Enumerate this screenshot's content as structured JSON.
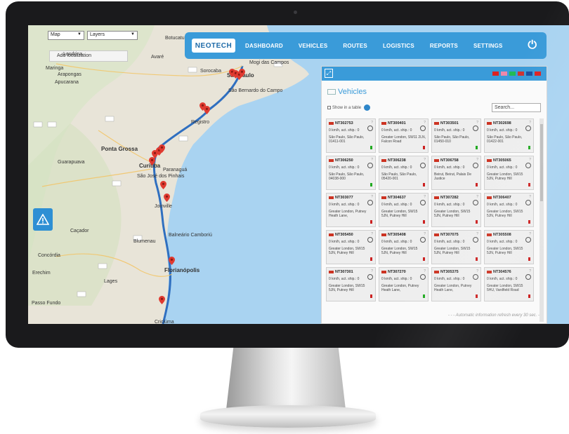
{
  "map": {
    "type_select": "Map",
    "layers_select": "Layers",
    "add_localization": "Add localization",
    "labels": [
      {
        "text": "Londrina",
        "cls": ""
      },
      {
        "text": "Maringa",
        "cls": ""
      },
      {
        "text": "Arapongas",
        "cls": ""
      },
      {
        "text": "Apucarana",
        "cls": ""
      },
      {
        "text": "Botucatu",
        "cls": ""
      },
      {
        "text": "Avaré",
        "cls": ""
      },
      {
        "text": "Sorocaba",
        "cls": ""
      },
      {
        "text": "São Paulo",
        "cls": "big"
      },
      {
        "text": "São Bernardo do Campo",
        "cls": ""
      },
      {
        "text": "Mogi das Campos",
        "cls": ""
      },
      {
        "text": "Registro",
        "cls": ""
      },
      {
        "text": "Ponta Grossa",
        "cls": "big"
      },
      {
        "text": "Guarapuava",
        "cls": ""
      },
      {
        "text": "Curitiba",
        "cls": "big"
      },
      {
        "text": "Paranaguá",
        "cls": ""
      },
      {
        "text": "São José dos Pinhais",
        "cls": ""
      },
      {
        "text": "Joinville",
        "cls": ""
      },
      {
        "text": "Caçador",
        "cls": ""
      },
      {
        "text": "Blumenau",
        "cls": ""
      },
      {
        "text": "Balneário Camboriú",
        "cls": ""
      },
      {
        "text": "Concórdia",
        "cls": ""
      },
      {
        "text": "Erechim",
        "cls": ""
      },
      {
        "text": "Lages",
        "cls": ""
      },
      {
        "text": "Florianópolis",
        "cls": "big"
      },
      {
        "text": "Passo Fundo",
        "cls": ""
      },
      {
        "text": "Criciúma",
        "cls": ""
      }
    ]
  },
  "nav": {
    "logo": "NEOTECH",
    "items": [
      "DASHBOARD",
      "VEHICLES",
      "ROUTES",
      "LOGISTICS",
      "REPORTS",
      "SETTINGS"
    ]
  },
  "panel": {
    "title": "Vehicles",
    "show_in_table": "Show in a table",
    "search_placeholder": "Search...",
    "refresh_note": "- - - Automatic information refresh every 30 sec. -",
    "flags": [
      "#d22",
      "#e8a",
      "#2b5",
      "#c33",
      "#1a4fa0",
      "#d22"
    ],
    "vehicles": [
      {
        "id": "NT302753",
        "speed": "0 km/h, act. ship.: 0",
        "addr": "São Paulo, São Paulo, 01411-001",
        "sig": "#2a2"
      },
      {
        "id": "NT300401",
        "speed": "0 km/h, act. ship.: 0",
        "addr": "Greater London, SW11 2LN, Falcon Road",
        "sig": "#c22"
      },
      {
        "id": "NT303501",
        "speed": "0 km/h, act. ship.: 0",
        "addr": "São Paulo, São Paulo, 01450-010",
        "sig": "#2a2"
      },
      {
        "id": "NT302698",
        "speed": "0 km/h, act. ship.: 0",
        "addr": "São Paulo, São Paulo, 01422-001",
        "sig": "#2a2"
      },
      {
        "id": "NT306250",
        "speed": "0 km/h, act. ship.: 0",
        "addr": "São Paulo, São Paulo, 04038-000",
        "sig": "#2a2"
      },
      {
        "id": "NT306238",
        "speed": "0 km/h, act. ship.: 0",
        "addr": "São Paulo, São Paulo, 05420-001",
        "sig": "#c22"
      },
      {
        "id": "NT306758",
        "speed": "0 km/h, act. ship.: 0",
        "addr": "Beirut, Beirut, Palais De Justice",
        "sig": "#c22"
      },
      {
        "id": "NT305065",
        "speed": "0 km/h, act. ship.: 0",
        "addr": "Greater London, SW15 5JN, Putney Hill",
        "sig": "#c22"
      },
      {
        "id": "NT303077",
        "speed": "0 km/h, act. ship.: 0",
        "addr": "Greater London, Putney Heath Lane,",
        "sig": "#c22"
      },
      {
        "id": "NT304637",
        "speed": "0 km/h, act. ship.: 0",
        "addr": "Greater London, SW15 5JN, Putney Hill",
        "sig": "#c22"
      },
      {
        "id": "NT307282",
        "speed": "0 km/h, act. ship.: 0",
        "addr": "Greater London, SW15 5JN, Putney Hill",
        "sig": "#c22"
      },
      {
        "id": "NT306407",
        "speed": "0 km/h, act. ship.: 0",
        "addr": "Greater London, SW15 5JN, Putney Hill",
        "sig": "#c22"
      },
      {
        "id": "NT305450",
        "speed": "0 km/h, act. ship.: 0",
        "addr": "Greater London, SW15 5JN, Putney Hill",
        "sig": "#c22"
      },
      {
        "id": "NT305408",
        "speed": "0 km/h, act. ship.: 0",
        "addr": "Greater London, SW15 5JN, Putney Hill",
        "sig": "#c22"
      },
      {
        "id": "NT307075",
        "speed": "0 km/h, act. ship.: 0",
        "addr": "Greater London, SW15 5JN, Putney Hill",
        "sig": "#c22"
      },
      {
        "id": "NT305508",
        "speed": "0 km/h, act. ship.: 0",
        "addr": "Greater London, SW15 5JN, Putney Hill",
        "sig": "#c22"
      },
      {
        "id": "NT307301",
        "speed": "0 km/h, act. ship.: 0",
        "addr": "Greater London, SW15 5JN, Putney Hill",
        "sig": "#c22"
      },
      {
        "id": "NT307270",
        "speed": "0 km/h, act. ship.: 0",
        "addr": "Greater London, Putney Heath Lane,",
        "sig": "#2a2"
      },
      {
        "id": "NT305375",
        "speed": "0 km/h, act. ship.: 0",
        "addr": "Greater London, Putney Heath Lane,",
        "sig": "#c22"
      },
      {
        "id": "NT304576",
        "speed": "0 km/h, act. ship.: 0",
        "addr": "Greater London, SW15 5HU, Vardfield Road",
        "sig": "#c22"
      }
    ]
  },
  "colors": {
    "accent": "#3a9bd9",
    "route": "#2f6fc0",
    "pin": "#e03a30",
    "land": "#e8e4d8",
    "water": "#a9d3f1"
  }
}
